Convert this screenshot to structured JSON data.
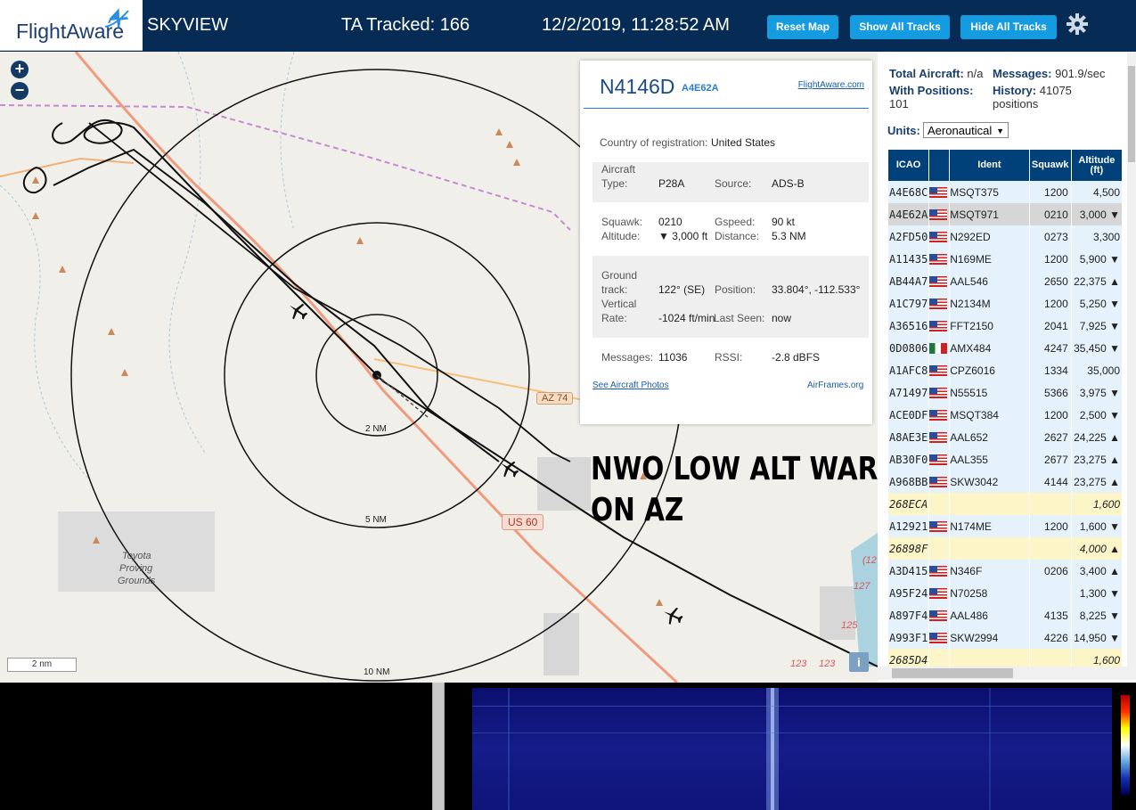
{
  "header": {
    "logo_text": "FlightAware",
    "app_title": "SKYVIEW",
    "tracked": "TA Tracked: 166",
    "datetime": "12/2/2019, 11:28:52 AM",
    "buttons": {
      "reset_map": "Reset Map",
      "show_all": "Show All Tracks",
      "hide_all": "Hide All Tracks"
    }
  },
  "map": {
    "labels": {
      "ring_2": "2 NM",
      "ring_5": "5 NM",
      "ring_10": "10 NM",
      "road_az74": "AZ 74",
      "road_us60": "US 60",
      "toyota_1": "Toyota",
      "toyota_2": "Proving",
      "toyota_3": "Grounds",
      "r127": "127",
      "r125": "125",
      "r123": "123",
      "r123b": "123",
      "r12": "(12",
      "r127b": "127"
    },
    "scale": "2 nm",
    "info_button": "i",
    "overlay_line1": "NWO LOW ALT WAR",
    "overlay_line2": "ON AZ"
  },
  "popup": {
    "registration": "N4146D",
    "hex": "A4E62A",
    "flightaware_link": "FlightAware.com",
    "country_label": "Country of registration:",
    "country_value": "United States",
    "aircraft_type_label_1": "Aircraft",
    "aircraft_type_label_2": "Type:",
    "aircraft_type": "P28A",
    "source_label": "Source:",
    "source": "ADS-B",
    "squawk_label": "Squawk:",
    "squawk": "0210",
    "gspeed_label": "Gspeed:",
    "gspeed": "90 kt",
    "altitude_label": "Altitude:",
    "altitude": "▼ 3,000 ft",
    "distance_label": "Distance:",
    "distance": "5.3 NM",
    "track_label_1": "Ground",
    "track_label_2": "track:",
    "track": "122° (SE)",
    "position_label": "Position:",
    "position": "33.804°, -112.533°",
    "vrate_label_1": "Vertical",
    "vrate_label_2": "Rate:",
    "vrate": "-1024 ft/min",
    "last_seen_label": "Last Seen:",
    "last_seen": "now",
    "messages_label": "Messages:",
    "messages": "11036",
    "rssi_label": "RSSI:",
    "rssi": "-2.8 dBFS",
    "photos_link": "See Aircraft Photos",
    "airframes_link": "AirFrames.org"
  },
  "sidebar": {
    "total_label": "Total Aircraft:",
    "total_value": "n/a",
    "messages_label": "Messages:",
    "messages_value": "901.9/sec",
    "withpos_label": "With Positions:",
    "withpos_value": "101",
    "history_label": "History:",
    "history_value": "41075",
    "history_unit": "positions",
    "units_label": "Units:",
    "units_value": "Aeronautical",
    "columns": [
      "ICAO",
      "",
      "Ident",
      "Squawk",
      "Altitude (ft)"
    ],
    "rows": [
      {
        "icao": "A4E68C",
        "flag": "us",
        "ident": "MSQT375",
        "squawk": "1200",
        "alt": "4,500"
      },
      {
        "icao": "A4E62A",
        "flag": "us",
        "ident": "MSQT971",
        "squawk": "0210",
        "alt": "3,000 ▼",
        "selected": true
      },
      {
        "icao": "A2FD50",
        "flag": "us",
        "ident": "N292ED",
        "squawk": "0273",
        "alt": "3,300"
      },
      {
        "icao": "A11435",
        "flag": "us",
        "ident": "N169ME",
        "squawk": "1200",
        "alt": "5,900 ▼"
      },
      {
        "icao": "AB44A7",
        "flag": "us",
        "ident": "AAL546",
        "squawk": "2650",
        "alt": "22,375 ▲"
      },
      {
        "icao": "A1C797",
        "flag": "us",
        "ident": "N2134M",
        "squawk": "1200",
        "alt": "5,250 ▼"
      },
      {
        "icao": "A36516",
        "flag": "us",
        "ident": "FFT2150",
        "squawk": "2041",
        "alt": "7,925 ▼"
      },
      {
        "icao": "0D0806",
        "flag": "mx",
        "ident": "AMX484",
        "squawk": "4247",
        "alt": "35,450 ▼"
      },
      {
        "icao": "A1AFC8",
        "flag": "us",
        "ident": "CPZ6016",
        "squawk": "1334",
        "alt": "35,000"
      },
      {
        "icao": "A71497",
        "flag": "us",
        "ident": "N55515",
        "squawk": "5366",
        "alt": "3,975 ▼"
      },
      {
        "icao": "ACE0DF",
        "flag": "us",
        "ident": "MSQT384",
        "squawk": "1200",
        "alt": "2,500 ▼"
      },
      {
        "icao": "A8AE3E",
        "flag": "us",
        "ident": "AAL652",
        "squawk": "2627",
        "alt": "24,225 ▲"
      },
      {
        "icao": "AB30F0",
        "flag": "us",
        "ident": "AAL355",
        "squawk": "2677",
        "alt": "23,275 ▲"
      },
      {
        "icao": "A968BB",
        "flag": "us",
        "ident": "SKW3042",
        "squawk": "4144",
        "alt": "23,275 ▲"
      },
      {
        "icao": "268ECA",
        "flag": "",
        "ident": "",
        "squawk": "",
        "alt": "1,600",
        "nopos": true
      },
      {
        "icao": "A12921",
        "flag": "us",
        "ident": "N174ME",
        "squawk": "1200",
        "alt": "1,600 ▼"
      },
      {
        "icao": "26898F",
        "flag": "",
        "ident": "",
        "squawk": "",
        "alt": "4,000 ▲",
        "nopos": true
      },
      {
        "icao": "A3D415",
        "flag": "us",
        "ident": "N346F",
        "squawk": "0206",
        "alt": "3,400 ▲"
      },
      {
        "icao": "A95F24",
        "flag": "us",
        "ident": "N70258",
        "squawk": "",
        "alt": "1,300 ▼"
      },
      {
        "icao": "A897F4",
        "flag": "us",
        "ident": "AAL486",
        "squawk": "4135",
        "alt": "8,225 ▼"
      },
      {
        "icao": "A993F1",
        "flag": "us",
        "ident": "SKW2994",
        "squawk": "4226",
        "alt": "14,950 ▼"
      },
      {
        "icao": "2685D4",
        "flag": "",
        "ident": "",
        "squawk": "",
        "alt": "1,600",
        "nopos": true
      }
    ]
  },
  "colors": {
    "header_bg": "#062c55",
    "button_blue": "#149be0",
    "table_header": "#00417a",
    "row_bg": "#e5f2fb",
    "nopos_bg": "#fcf5c8",
    "selected_bg": "#d6d6d6"
  }
}
